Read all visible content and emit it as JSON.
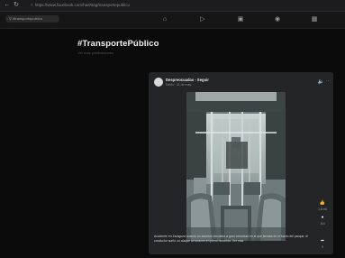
{
  "browser": {
    "url": "https://www.facebook.com/hashtag/transportepublico"
  },
  "facebook": {
    "search_placeholder": "#transportepublico",
    "nav_icons": [
      "home-icon",
      "video-icon",
      "marketplace-icon",
      "groups-icon",
      "gaming-icon"
    ]
  },
  "hashtag": {
    "title": "#TransportePúblico",
    "subtitle": "Ver más publicaciones"
  },
  "post": {
    "author": "Despreocuadas - Seguir",
    "meta": "Reels · 11 de may. ·",
    "caption": "Accidente en Zaragoza cuando un autobús circulaba a gran velocidad en el que llevaba en el barrio del parque, el conductor sufrió un ataque al corazón en pleno recorrido. Ver más",
    "likes": "1,8 mil",
    "comments": "104",
    "shares": "9"
  },
  "colors": {
    "page_bg": "#0b0b0b",
    "card_bg": "#242526",
    "text_primary": "#e4e6eb"
  }
}
